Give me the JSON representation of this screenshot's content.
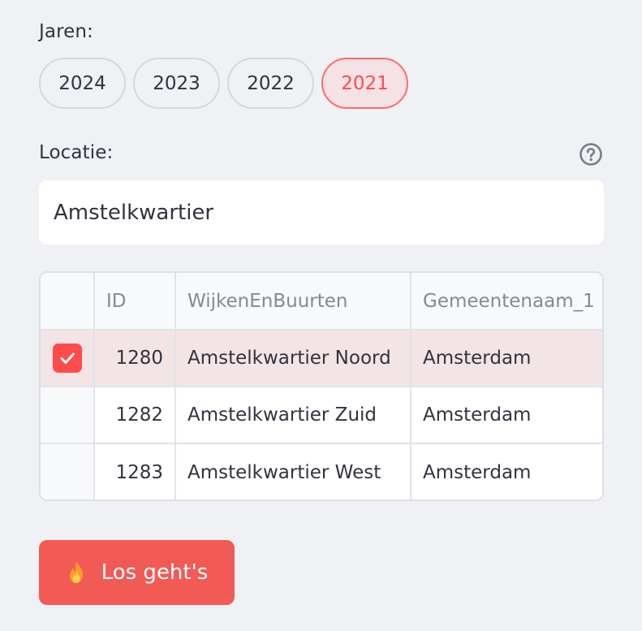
{
  "years": {
    "label": "Jaren:",
    "options": [
      {
        "label": "2024",
        "selected": false
      },
      {
        "label": "2023",
        "selected": false
      },
      {
        "label": "2022",
        "selected": false
      },
      {
        "label": "2021",
        "selected": true
      }
    ]
  },
  "location": {
    "label": "Locatie:",
    "help_icon": "question-circle-icon",
    "input_value": "Amstelkwartier"
  },
  "table": {
    "columns": [
      "ID",
      "WijkenEnBuurten",
      "Gemeentenaam_1"
    ],
    "rows": [
      {
        "selected": true,
        "id": "1280",
        "wijk": "Amstelkwartier Noord",
        "gemeente": "Amsterdam"
      },
      {
        "selected": false,
        "id": "1282",
        "wijk": "Amstelkwartier Zuid",
        "gemeente": "Amsterdam"
      },
      {
        "selected": false,
        "id": "1283",
        "wijk": "Amstelkwartier West",
        "gemeente": "Amsterdam"
      }
    ]
  },
  "submit": {
    "icon": "fire-icon",
    "label": "Los geht's"
  },
  "colors": {
    "accent": "#ff4b4b",
    "background": "#f0f1f5"
  }
}
